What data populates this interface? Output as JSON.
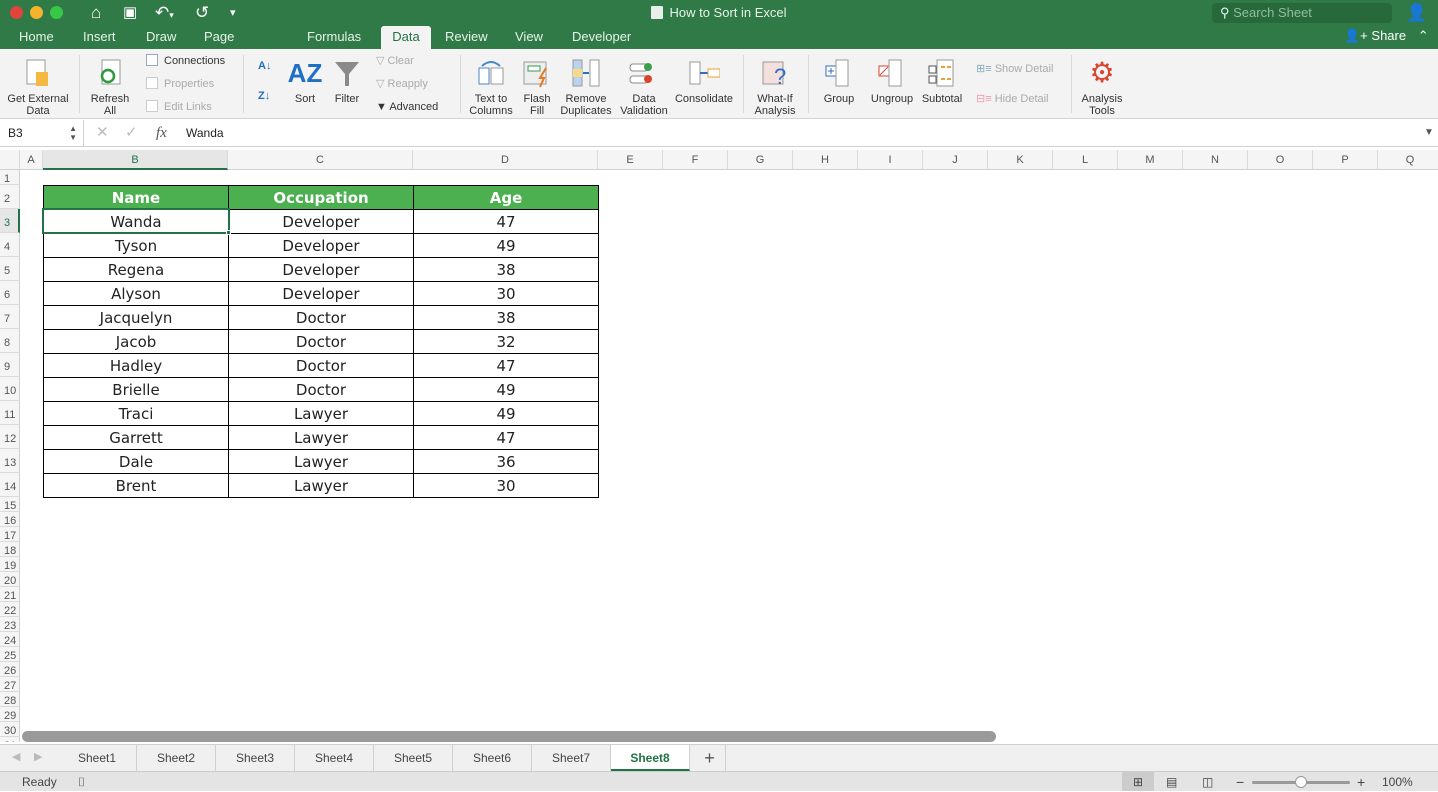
{
  "window": {
    "title": "How to Sort in Excel",
    "search_placeholder": "Search Sheet",
    "share_label": "Share"
  },
  "menu_tabs": [
    "Home",
    "Insert",
    "Draw",
    "Page Layout",
    "Formulas",
    "Data",
    "Review",
    "View",
    "Developer"
  ],
  "active_tab": "Data",
  "ribbon": {
    "get_external": "Get External Data",
    "refresh_1": "Refresh",
    "refresh_2": "All",
    "connections": "Connections",
    "properties": "Properties",
    "edit_links": "Edit Links",
    "sort": "Sort",
    "filter": "Filter",
    "clear": "Clear",
    "reapply": "Reapply",
    "advanced": "Advanced",
    "text_to_columns_1": "Text to",
    "text_to_columns_2": "Columns",
    "flash_fill_1": "Flash",
    "flash_fill_2": "Fill",
    "remove_dup_1": "Remove",
    "remove_dup_2": "Duplicates",
    "data_val_1": "Data",
    "data_val_2": "Validation",
    "consolidate": "Consolidate",
    "whatif_1": "What-If",
    "whatif_2": "Analysis",
    "group": "Group",
    "ungroup": "Ungroup",
    "subtotal": "Subtotal",
    "show_detail": "Show Detail",
    "hide_detail": "Hide Detail",
    "analysis_1": "Analysis",
    "analysis_2": "Tools"
  },
  "formula_bar": {
    "name_box": "B3",
    "value": "Wanda"
  },
  "columns": [
    "A",
    "B",
    "C",
    "D",
    "E",
    "F",
    "G",
    "H",
    "I",
    "J",
    "K",
    "L",
    "M",
    "N",
    "O",
    "P",
    "Q"
  ],
  "table": {
    "headers": [
      "Name",
      "Occupation",
      "Age"
    ],
    "rows": [
      [
        "Wanda",
        "Developer",
        "47"
      ],
      [
        "Tyson",
        "Developer",
        "49"
      ],
      [
        "Regena",
        "Developer",
        "38"
      ],
      [
        "Alyson",
        "Developer",
        "30"
      ],
      [
        "Jacquelyn",
        "Doctor",
        "38"
      ],
      [
        "Jacob",
        "Doctor",
        "32"
      ],
      [
        "Hadley",
        "Doctor",
        "47"
      ],
      [
        "Brielle",
        "Doctor",
        "49"
      ],
      [
        "Traci",
        "Lawyer",
        "49"
      ],
      [
        "Garrett",
        "Lawyer",
        "47"
      ],
      [
        "Dale",
        "Lawyer",
        "36"
      ],
      [
        "Brent",
        "Lawyer",
        "30"
      ]
    ]
  },
  "sheets": [
    "Sheet1",
    "Sheet2",
    "Sheet3",
    "Sheet4",
    "Sheet5",
    "Sheet6",
    "Sheet7",
    "Sheet8"
  ],
  "active_sheet": "Sheet8",
  "status": {
    "ready": "Ready",
    "zoom": "100%",
    "zoom_fraction": 0.5
  }
}
